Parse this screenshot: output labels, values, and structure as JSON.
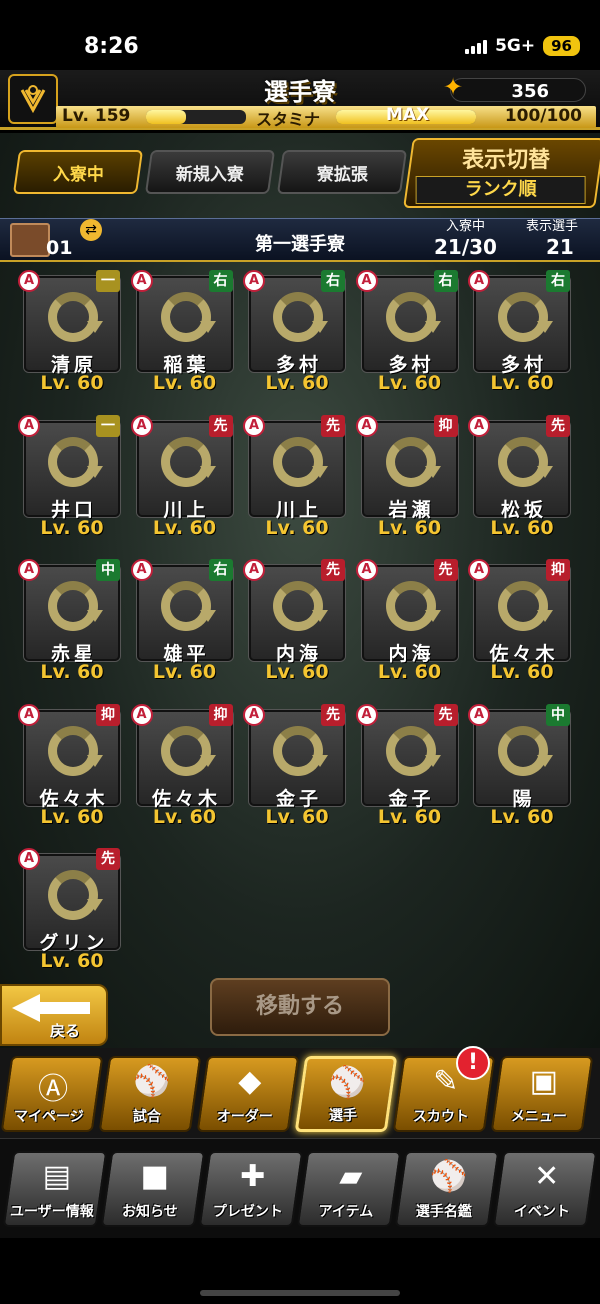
{
  "status_bar": {
    "time": "8:26",
    "network": "5G+",
    "battery": "96"
  },
  "header": {
    "title": "選手寮",
    "currency": "356",
    "level": "Lv. 159",
    "stamina_label": "スタミナ",
    "stamina_max": "MAX",
    "stamina_value": "100/100",
    "stamina_fraction": 1.0
  },
  "tabs": [
    "入寮中",
    "新規入寮",
    "寮拡張"
  ],
  "sort": {
    "title": "表示切替",
    "value": "ランク順"
  },
  "dorm": {
    "number": "01",
    "name": "第一選手寮",
    "in_dorm_label": "入寮中",
    "in_dorm_value": "21/30",
    "shown_label": "表示選手",
    "shown_value": "21"
  },
  "players": [
    {
      "name": "清原",
      "pos": "一",
      "lv": "Lv. 60",
      "badge": "A"
    },
    {
      "name": "稲葉",
      "pos": "右",
      "lv": "Lv. 60",
      "badge": "A"
    },
    {
      "name": "多村",
      "pos": "右",
      "lv": "Lv. 60",
      "badge": "A"
    },
    {
      "name": "多村",
      "pos": "右",
      "lv": "Lv. 60",
      "badge": "A"
    },
    {
      "name": "多村",
      "pos": "右",
      "lv": "Lv. 60",
      "badge": "A"
    },
    {
      "name": "井口",
      "pos": "一",
      "lv": "Lv. 60",
      "badge": "A"
    },
    {
      "name": "川上",
      "pos": "先",
      "lv": "Lv. 60",
      "badge": "A"
    },
    {
      "name": "川上",
      "pos": "先",
      "lv": "Lv. 60",
      "badge": "A"
    },
    {
      "name": "岩瀬",
      "pos": "抑",
      "lv": "Lv. 60",
      "badge": "A"
    },
    {
      "name": "松坂",
      "pos": "先",
      "lv": "Lv. 60",
      "badge": "A"
    },
    {
      "name": "赤星",
      "pos": "中",
      "lv": "Lv. 60",
      "badge": "A"
    },
    {
      "name": "雄平",
      "pos": "右",
      "lv": "Lv. 60",
      "badge": "A"
    },
    {
      "name": "内海",
      "pos": "先",
      "lv": "Lv. 60",
      "badge": "A"
    },
    {
      "name": "内海",
      "pos": "先",
      "lv": "Lv. 60",
      "badge": "A"
    },
    {
      "name": "佐々木",
      "pos": "抑",
      "lv": "Lv. 60",
      "badge": "A"
    },
    {
      "name": "佐々木",
      "pos": "抑",
      "lv": "Lv. 60",
      "badge": "A"
    },
    {
      "name": "佐々木",
      "pos": "抑",
      "lv": "Lv. 60",
      "badge": "A"
    },
    {
      "name": "金子",
      "pos": "先",
      "lv": "Lv. 60",
      "badge": "A"
    },
    {
      "name": "金子",
      "pos": "先",
      "lv": "Lv. 60",
      "badge": "A"
    },
    {
      "name": "陽",
      "pos": "中",
      "lv": "Lv. 60",
      "badge": "A"
    },
    {
      "name": "グリン",
      "pos": "先",
      "lv": "Lv. 60",
      "badge": "A"
    }
  ],
  "actions": {
    "back": "戻る",
    "move": "移動する"
  },
  "nav_main": [
    {
      "label": "マイページ",
      "icon": "home-icon"
    },
    {
      "label": "試合",
      "icon": "stadium-icon"
    },
    {
      "label": "オーダー",
      "icon": "lineup-icon"
    },
    {
      "label": "選手",
      "icon": "player-icon"
    },
    {
      "label": "スカウト",
      "icon": "scout-icon"
    },
    {
      "label": "メニュー",
      "icon": "menu-icon"
    }
  ],
  "nav_alert": "!",
  "nav_sub": [
    {
      "label": "ユーザー情報",
      "icon": "user-info-icon"
    },
    {
      "label": "お知らせ",
      "icon": "notice-icon"
    },
    {
      "label": "プレゼント",
      "icon": "gift-icon"
    },
    {
      "label": "アイテム",
      "icon": "item-icon"
    },
    {
      "label": "選手名鑑",
      "icon": "directory-icon"
    },
    {
      "label": "イベント",
      "icon": "event-icon"
    }
  ],
  "colors": {
    "accent": "#f0b830",
    "level_text": "#f4c531",
    "pitcher_badge": "#b81e2c",
    "fielder_badge": "#1b7a30"
  }
}
